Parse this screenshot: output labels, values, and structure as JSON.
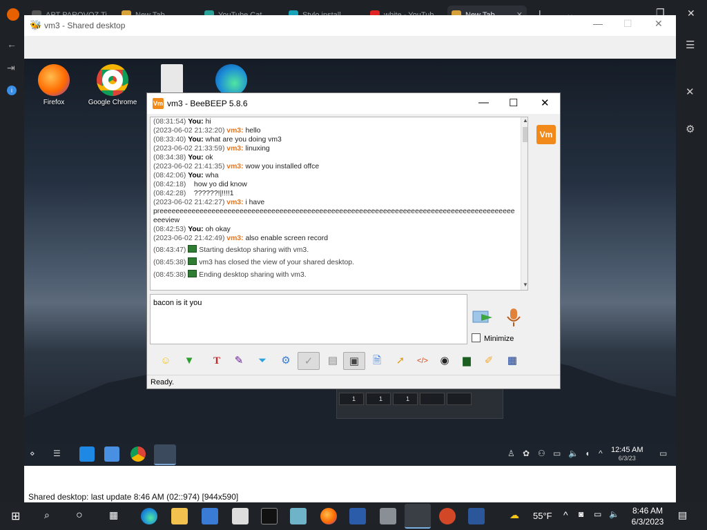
{
  "host_browser": {
    "tabs": [
      {
        "label": "APT PAROVOZ Ti..."
      },
      {
        "label": "New Tab"
      },
      {
        "label": "YouTube Cat..."
      },
      {
        "label": "Stylo install..."
      },
      {
        "label": "white - YouTub..."
      },
      {
        "label": "New Tab"
      }
    ]
  },
  "viewer": {
    "title": "vm3 - Shared desktop",
    "status": "Shared desktop: last update 8:46 AM (02::974) [944x590]"
  },
  "remote_desktop": {
    "icons": [
      {
        "label": "Firefox"
      },
      {
        "label": "Google Chrome"
      },
      {
        "label": ""
      },
      {
        "label": ""
      }
    ],
    "taskbar": {
      "time": "12:45 AM",
      "date": "6/3/23"
    },
    "strip": {
      "b1": "1",
      "b2": "1",
      "b3": "1"
    }
  },
  "beebeep": {
    "title": "vm3 - BeeBEEP 5.8.6",
    "avatar": "Vm",
    "messages": [
      {
        "ts": "(08:31:54)",
        "who": "You:",
        "text": " hi"
      },
      {
        "ts": "(2023-06-02 21:32:20)",
        "who": "vm3:",
        "text": " hello"
      },
      {
        "ts": "(08:33:40)",
        "who": "You:",
        "text": " what are you doing vm3"
      },
      {
        "ts": "(2023-06-02 21:33:59)",
        "who": "vm3:",
        "text": " linuxing"
      },
      {
        "ts": "(08:34:38)",
        "who": "You:",
        "text": " ok"
      },
      {
        "ts": "(2023-06-02 21:41:35)",
        "who": "vm3:",
        "text": " wow you installed offce"
      },
      {
        "ts": "(08:42:06)",
        "who": "You:",
        "text": " wha"
      },
      {
        "ts": "(08:42:18)",
        "who": "",
        "text": "    how yo did know"
      },
      {
        "ts": "(08:42:28)",
        "who": "",
        "text": "    ??????!|!!!!1"
      },
      {
        "ts": "(2023-06-02 21:42:27)",
        "who": "vm3:",
        "text": " i have"
      },
      {
        "ts": "",
        "who": "",
        "text": "preeeeeeeeeeeeeeeeeeeeeeeeeeeeeeeeeeeeeeeeeeeeeeeeeeeeeeeeeeeeeeeeeeeeeeeeeeeeeeeeeeeeeeeeeeeeview"
      },
      {
        "ts": "(08:42:53)",
        "who": "You:",
        "text": " oh okay"
      },
      {
        "ts": "(2023-06-02 21:42:49)",
        "who": "vm3:",
        "text": " also enable screen record"
      },
      {
        "ts": "(08:43:47)",
        "who": "",
        "text": "Starting desktop sharing with vm3."
      },
      {
        "ts": "(08:45:38)",
        "who": "",
        "text": "vm3 has closed the view of your shared desktop."
      },
      {
        "ts": "(08:45:38)",
        "who": "",
        "text": "Ending desktop sharing with vm3."
      }
    ],
    "input_text": "bacon is it you",
    "minimize_label": "Minimize",
    "status": "Ready."
  },
  "taskbar": {
    "temperature": "55°F",
    "time": "8:46 AM",
    "date": "6/3/2023"
  },
  "colors": {
    "accent_orange": "#e8741a",
    "beebeep_icon": "#f28a1b",
    "taskbar": "#1f2328"
  }
}
